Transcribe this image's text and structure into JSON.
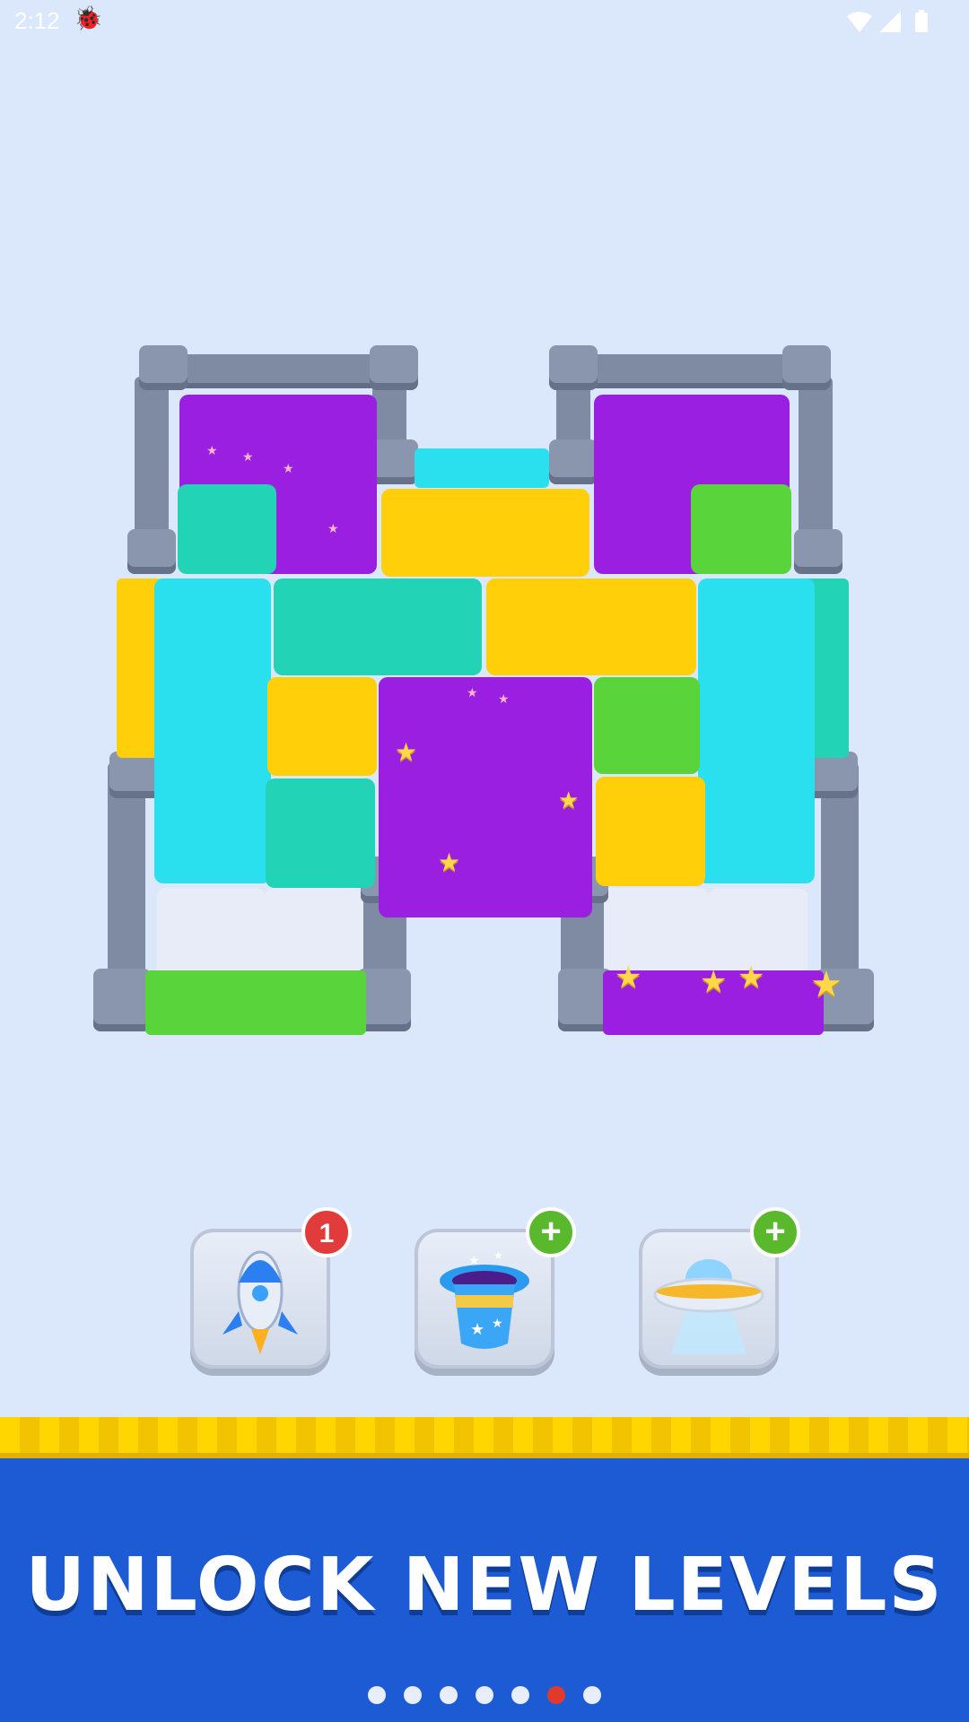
{
  "status_bar": {
    "time": "2:12",
    "bug_icon": "bug-icon",
    "wifi_icon": "wifi-icon",
    "signal_icon": "signal-icon",
    "battery_icon": "battery-icon"
  },
  "colors": {
    "background": "#dbe7fb",
    "purple": "#9b1fe0",
    "teal": "#22d3b5",
    "yellow": "#ffcf0a",
    "green": "#59d43a",
    "cyan": "#2ae0ef",
    "wall": "#7f8ba3",
    "banner": "#1d5bd4",
    "banner_trim": "#ffd600"
  },
  "boosters": [
    {
      "name": "rocket",
      "icon": "rocket-icon",
      "badge": "1",
      "badge_type": "count"
    },
    {
      "name": "magic-hat",
      "icon": "magic-hat-icon",
      "badge": "+",
      "badge_type": "add"
    },
    {
      "name": "ufo",
      "icon": "ufo-icon",
      "badge": "+",
      "badge_type": "add"
    }
  ],
  "banner": {
    "title": "UNLOCK NEW LEVELS"
  },
  "pagination": {
    "total": 7,
    "active_index": 5
  }
}
